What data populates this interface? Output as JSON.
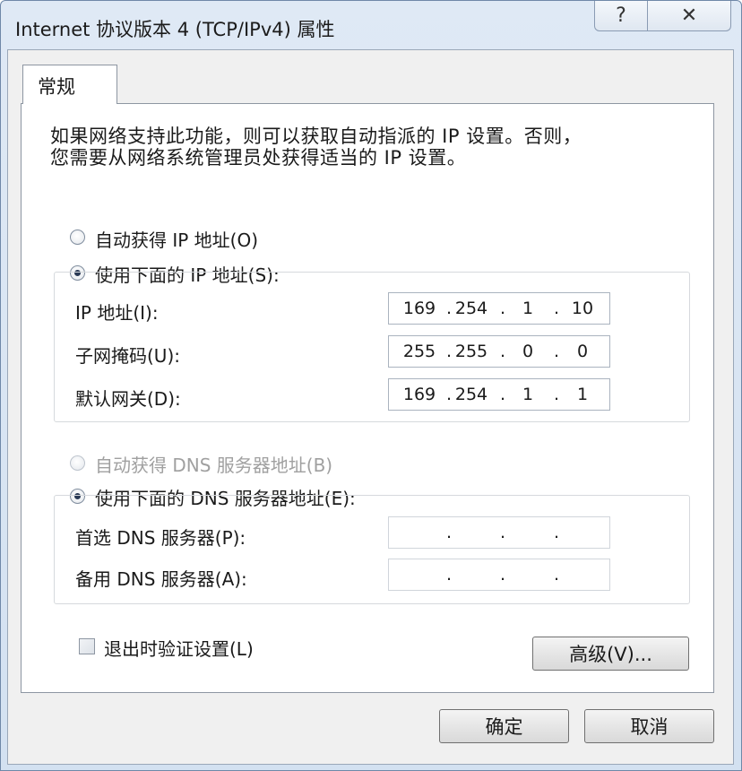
{
  "window": {
    "title": "Internet 协议版本 4 (TCP/IPv4) 属性",
    "help_glyph": "?",
    "close_glyph": "✕"
  },
  "tabs": [
    {
      "label": "常规"
    }
  ],
  "description": {
    "line1": "如果网络支持此功能，则可以获取自动指派的 IP 设置。否则，",
    "line2": "您需要从网络系统管理员处获得适当的 IP 设置。"
  },
  "ip_section": {
    "auto_label": "自动获得 IP 地址(O)",
    "manual_label": "使用下面的 IP 地址(S):",
    "selected": "manual",
    "fields": [
      {
        "label": "IP 地址(I):",
        "octets": [
          "169",
          "254",
          "1",
          "10"
        ]
      },
      {
        "label": "子网掩码(U):",
        "octets": [
          "255",
          "255",
          "0",
          "0"
        ]
      },
      {
        "label": "默认网关(D):",
        "octets": [
          "169",
          "254",
          "1",
          "1"
        ]
      }
    ]
  },
  "dns_section": {
    "auto_label": "自动获得 DNS 服务器地址(B)",
    "manual_label": "使用下面的 DNS 服务器地址(E):",
    "selected": "manual",
    "fields": [
      {
        "label": "首选 DNS 服务器(P):",
        "octets": [
          "",
          "",
          "",
          ""
        ]
      },
      {
        "label": "备用 DNS 服务器(A):",
        "octets": [
          "",
          "",
          "",
          ""
        ]
      }
    ]
  },
  "validate_checkbox": {
    "label": "退出时验证设置(L)",
    "checked": false
  },
  "buttons": {
    "advanced": "高级(V)...",
    "ok": "确定",
    "cancel": "取消"
  },
  "ip_dot": "."
}
